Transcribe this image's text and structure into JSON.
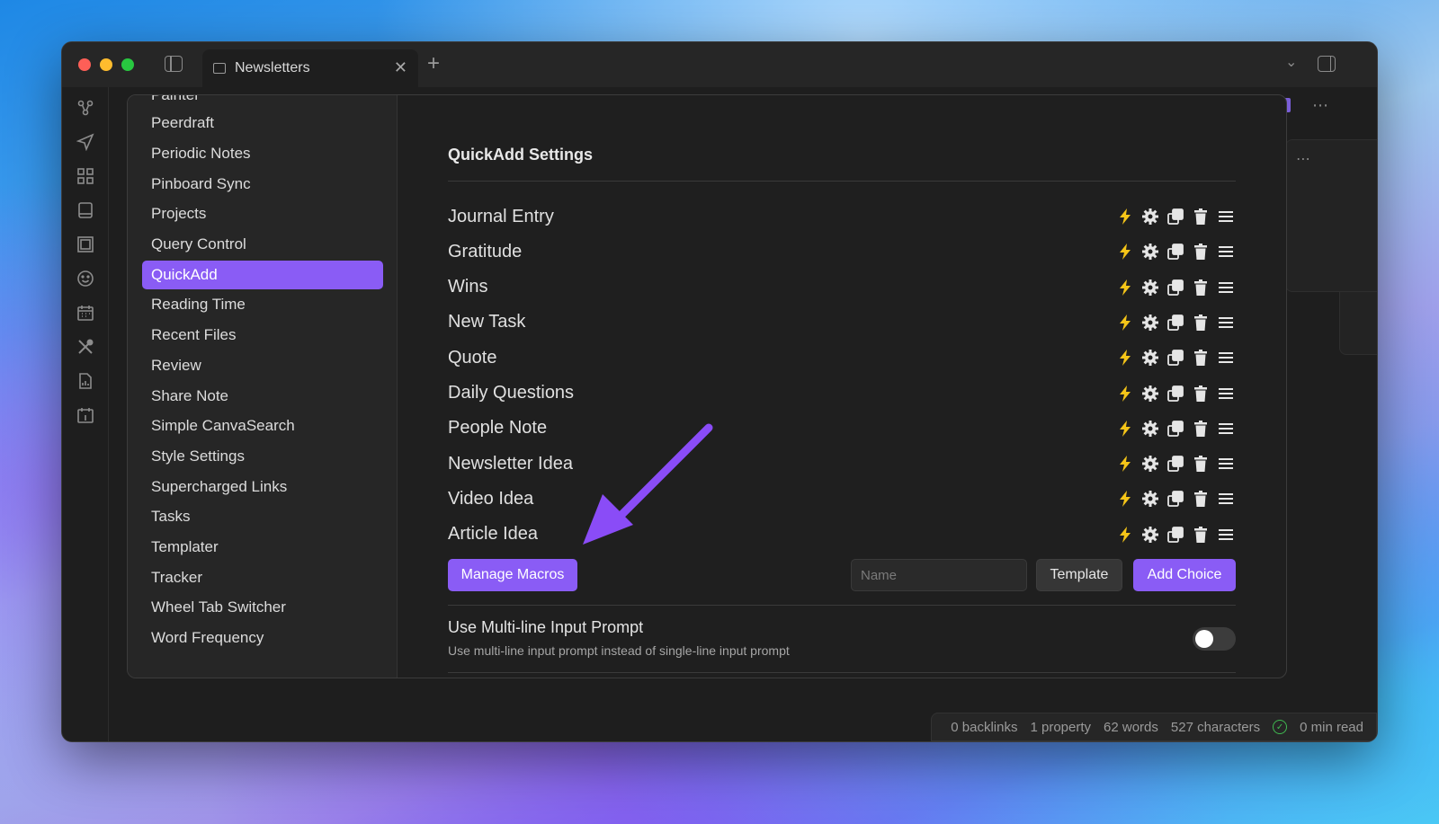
{
  "window": {
    "tab_title": "Newsletters",
    "new_tab": "+",
    "close": "✕"
  },
  "settings_sidebar": {
    "items": [
      {
        "label": "Painter"
      },
      {
        "label": "Peerdraft"
      },
      {
        "label": "Periodic Notes"
      },
      {
        "label": "Pinboard Sync"
      },
      {
        "label": "Projects"
      },
      {
        "label": "Query Control"
      },
      {
        "label": "QuickAdd",
        "active": true
      },
      {
        "label": "Reading Time"
      },
      {
        "label": "Recent Files"
      },
      {
        "label": "Review"
      },
      {
        "label": "Share Note"
      },
      {
        "label": "Simple CanvaSearch"
      },
      {
        "label": "Style Settings"
      },
      {
        "label": "Supercharged Links"
      },
      {
        "label": "Tasks"
      },
      {
        "label": "Templater"
      },
      {
        "label": "Tracker"
      },
      {
        "label": "Wheel Tab Switcher"
      },
      {
        "label": "Word Frequency"
      }
    ]
  },
  "quickadd": {
    "title": "QuickAdd Settings",
    "choices": [
      {
        "name": "Journal Entry"
      },
      {
        "name": "Gratitude"
      },
      {
        "name": "Wins"
      },
      {
        "name": "New Task"
      },
      {
        "name": "Quote"
      },
      {
        "name": "Daily Questions"
      },
      {
        "name": "People Note"
      },
      {
        "name": "Newsletter Idea"
      },
      {
        "name": "Video Idea"
      },
      {
        "name": "Article Idea"
      }
    ],
    "manage_macros_label": "Manage Macros",
    "name_placeholder": "Name",
    "template_label": "Template",
    "add_choice_label": "Add Choice",
    "multiline": {
      "name": "Use Multi-line Input Prompt",
      "desc": "Use multi-line input prompt instead of single-line input prompt",
      "enabled": false
    }
  },
  "status": {
    "backlinks": "0 backlinks",
    "property": "1 property",
    "words": "62 words",
    "characters": "527 characters",
    "read": "0 min read"
  },
  "colors": {
    "accent": "#8a5cf5",
    "bolt": "#f5c518",
    "arrow": "#8a4cf7",
    "sync_ok": "#3fb950"
  }
}
